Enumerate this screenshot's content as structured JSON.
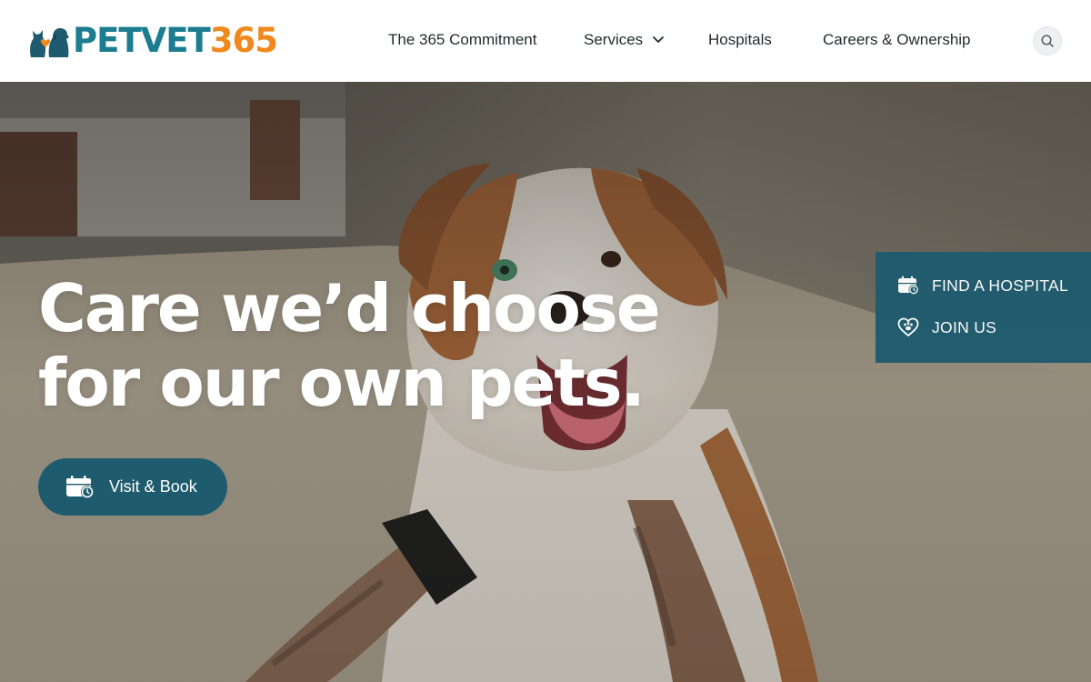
{
  "header": {
    "logo": {
      "text_pet": "PETVET",
      "text_num": "365",
      "icon": "pets-silhouette-icon",
      "colors": {
        "teal": "#1c7d90",
        "orange": "#f0891d"
      }
    },
    "nav": [
      {
        "label": "The 365 Commitment"
      },
      {
        "label": "Services",
        "icon": "chevron-down-icon"
      },
      {
        "label": "Hospitals"
      },
      {
        "label": "Careers & Ownership"
      }
    ],
    "search": {
      "icon": "search-icon"
    }
  },
  "hero": {
    "headline_line1": "Care we’d choose",
    "headline_line2": "for our own pets.",
    "cta": {
      "label": "Visit & Book",
      "icon": "calendar-clock-icon"
    },
    "background": "dog-photo"
  },
  "side_panel": {
    "links": [
      {
        "label": "FIND A HOSPITAL",
        "icon": "calendar-clock-icon"
      },
      {
        "label": "JOIN US",
        "icon": "heart-paw-icon"
      }
    ]
  },
  "colors": {
    "brand_dark": "#1f5b6e",
    "text": "#1f2a30"
  }
}
